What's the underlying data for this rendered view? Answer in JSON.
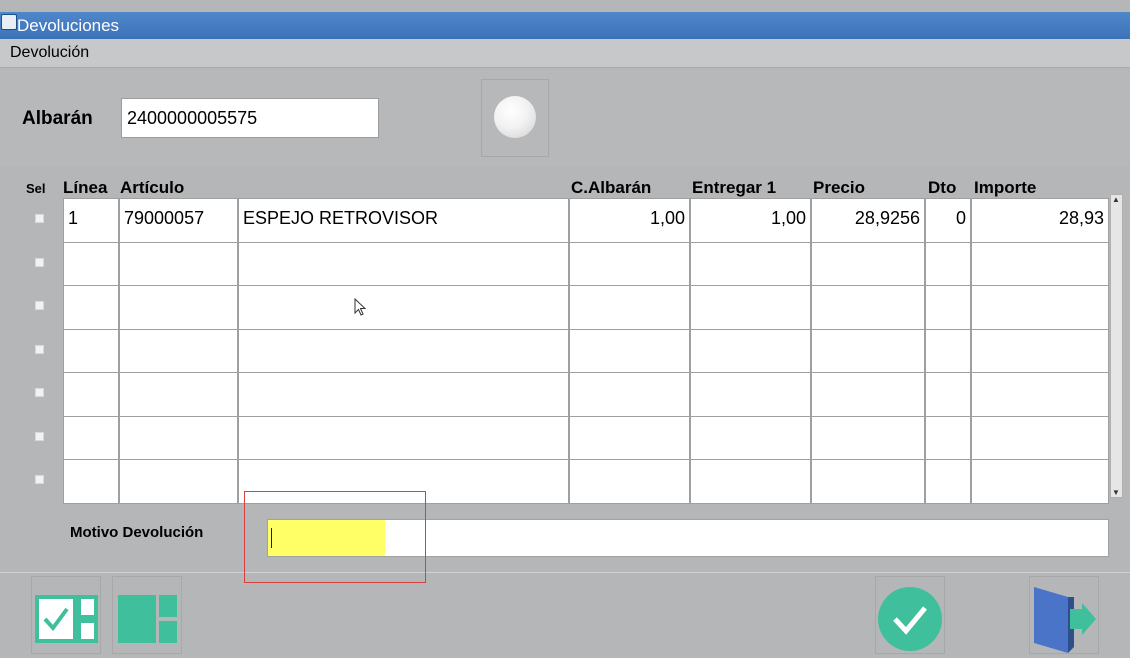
{
  "window": {
    "title": "Devoluciones"
  },
  "menu": {
    "items": [
      "Devolución"
    ]
  },
  "albaran": {
    "label": "Albarán",
    "value": "2400000005575"
  },
  "grid": {
    "headers": {
      "sel": "Sel",
      "linea": "Línea",
      "articulo": "Artículo",
      "c_albaran": "C.Albarán",
      "entregar": "Entregar 1",
      "precio": "Precio",
      "dto": "Dto",
      "importe": "Importe"
    },
    "rows": [
      {
        "linea": "1",
        "codigo": "79000057",
        "descripcion": "ESPEJO RETROVISOR",
        "c_albaran": "1,00",
        "entregar": "1,00",
        "precio": "28,9256",
        "dto": "0",
        "importe": "28,93"
      },
      {
        "linea": "",
        "codigo": "",
        "descripcion": "",
        "c_albaran": "",
        "entregar": "",
        "precio": "",
        "dto": "",
        "importe": ""
      },
      {
        "linea": "",
        "codigo": "",
        "descripcion": "",
        "c_albaran": "",
        "entregar": "",
        "precio": "",
        "dto": "",
        "importe": ""
      },
      {
        "linea": "",
        "codigo": "",
        "descripcion": "",
        "c_albaran": "",
        "entregar": "",
        "precio": "",
        "dto": "",
        "importe": ""
      },
      {
        "linea": "",
        "codigo": "",
        "descripcion": "",
        "c_albaran": "",
        "entregar": "",
        "precio": "",
        "dto": "",
        "importe": ""
      },
      {
        "linea": "",
        "codigo": "",
        "descripcion": "",
        "c_albaran": "",
        "entregar": "",
        "precio": "",
        "dto": "",
        "importe": ""
      },
      {
        "linea": "",
        "codigo": "",
        "descripcion": "",
        "c_albaran": "",
        "entregar": "",
        "precio": "",
        "dto": "",
        "importe": ""
      }
    ]
  },
  "motivo": {
    "label": "Motivo Devolución",
    "value": ""
  },
  "icons": {
    "select_all": "checkbox-grid-icon",
    "deselect_all": "grid-icon",
    "confirm": "check-circle-icon",
    "exit": "exit-door-icon",
    "clear": "circle-icon"
  },
  "colors": {
    "accent_green": "#3fbf9b",
    "exit_blue": "#4a74c8",
    "title_bar": "#4a80c4",
    "highlight_yellow": "#ffff66"
  }
}
